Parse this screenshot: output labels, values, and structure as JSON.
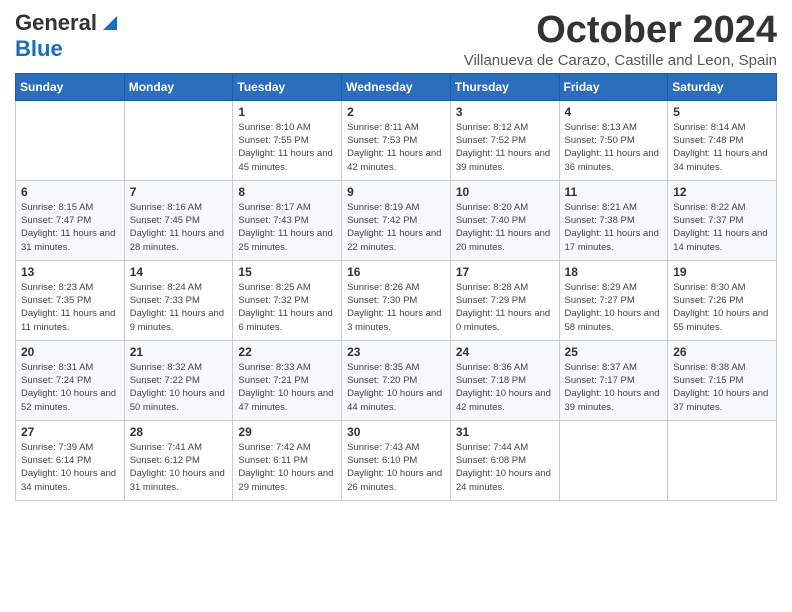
{
  "header": {
    "logo_general": "General",
    "logo_blue": "Blue",
    "month_title": "October 2024",
    "subtitle": "Villanueva de Carazo, Castille and Leon, Spain"
  },
  "weekdays": [
    "Sunday",
    "Monday",
    "Tuesday",
    "Wednesday",
    "Thursday",
    "Friday",
    "Saturday"
  ],
  "weeks": [
    [
      {
        "day": "",
        "info": ""
      },
      {
        "day": "",
        "info": ""
      },
      {
        "day": "1",
        "info": "Sunrise: 8:10 AM\nSunset: 7:55 PM\nDaylight: 11 hours and 45 minutes."
      },
      {
        "day": "2",
        "info": "Sunrise: 8:11 AM\nSunset: 7:53 PM\nDaylight: 11 hours and 42 minutes."
      },
      {
        "day": "3",
        "info": "Sunrise: 8:12 AM\nSunset: 7:52 PM\nDaylight: 11 hours and 39 minutes."
      },
      {
        "day": "4",
        "info": "Sunrise: 8:13 AM\nSunset: 7:50 PM\nDaylight: 11 hours and 36 minutes."
      },
      {
        "day": "5",
        "info": "Sunrise: 8:14 AM\nSunset: 7:48 PM\nDaylight: 11 hours and 34 minutes."
      }
    ],
    [
      {
        "day": "6",
        "info": "Sunrise: 8:15 AM\nSunset: 7:47 PM\nDaylight: 11 hours and 31 minutes."
      },
      {
        "day": "7",
        "info": "Sunrise: 8:16 AM\nSunset: 7:45 PM\nDaylight: 11 hours and 28 minutes."
      },
      {
        "day": "8",
        "info": "Sunrise: 8:17 AM\nSunset: 7:43 PM\nDaylight: 11 hours and 25 minutes."
      },
      {
        "day": "9",
        "info": "Sunrise: 8:19 AM\nSunset: 7:42 PM\nDaylight: 11 hours and 22 minutes."
      },
      {
        "day": "10",
        "info": "Sunrise: 8:20 AM\nSunset: 7:40 PM\nDaylight: 11 hours and 20 minutes."
      },
      {
        "day": "11",
        "info": "Sunrise: 8:21 AM\nSunset: 7:38 PM\nDaylight: 11 hours and 17 minutes."
      },
      {
        "day": "12",
        "info": "Sunrise: 8:22 AM\nSunset: 7:37 PM\nDaylight: 11 hours and 14 minutes."
      }
    ],
    [
      {
        "day": "13",
        "info": "Sunrise: 8:23 AM\nSunset: 7:35 PM\nDaylight: 11 hours and 11 minutes."
      },
      {
        "day": "14",
        "info": "Sunrise: 8:24 AM\nSunset: 7:33 PM\nDaylight: 11 hours and 9 minutes."
      },
      {
        "day": "15",
        "info": "Sunrise: 8:25 AM\nSunset: 7:32 PM\nDaylight: 11 hours and 6 minutes."
      },
      {
        "day": "16",
        "info": "Sunrise: 8:26 AM\nSunset: 7:30 PM\nDaylight: 11 hours and 3 minutes."
      },
      {
        "day": "17",
        "info": "Sunrise: 8:28 AM\nSunset: 7:29 PM\nDaylight: 11 hours and 0 minutes."
      },
      {
        "day": "18",
        "info": "Sunrise: 8:29 AM\nSunset: 7:27 PM\nDaylight: 10 hours and 58 minutes."
      },
      {
        "day": "19",
        "info": "Sunrise: 8:30 AM\nSunset: 7:26 PM\nDaylight: 10 hours and 55 minutes."
      }
    ],
    [
      {
        "day": "20",
        "info": "Sunrise: 8:31 AM\nSunset: 7:24 PM\nDaylight: 10 hours and 52 minutes."
      },
      {
        "day": "21",
        "info": "Sunrise: 8:32 AM\nSunset: 7:22 PM\nDaylight: 10 hours and 50 minutes."
      },
      {
        "day": "22",
        "info": "Sunrise: 8:33 AM\nSunset: 7:21 PM\nDaylight: 10 hours and 47 minutes."
      },
      {
        "day": "23",
        "info": "Sunrise: 8:35 AM\nSunset: 7:20 PM\nDaylight: 10 hours and 44 minutes."
      },
      {
        "day": "24",
        "info": "Sunrise: 8:36 AM\nSunset: 7:18 PM\nDaylight: 10 hours and 42 minutes."
      },
      {
        "day": "25",
        "info": "Sunrise: 8:37 AM\nSunset: 7:17 PM\nDaylight: 10 hours and 39 minutes."
      },
      {
        "day": "26",
        "info": "Sunrise: 8:38 AM\nSunset: 7:15 PM\nDaylight: 10 hours and 37 minutes."
      }
    ],
    [
      {
        "day": "27",
        "info": "Sunrise: 7:39 AM\nSunset: 6:14 PM\nDaylight: 10 hours and 34 minutes."
      },
      {
        "day": "28",
        "info": "Sunrise: 7:41 AM\nSunset: 6:12 PM\nDaylight: 10 hours and 31 minutes."
      },
      {
        "day": "29",
        "info": "Sunrise: 7:42 AM\nSunset: 6:11 PM\nDaylight: 10 hours and 29 minutes."
      },
      {
        "day": "30",
        "info": "Sunrise: 7:43 AM\nSunset: 6:10 PM\nDaylight: 10 hours and 26 minutes."
      },
      {
        "day": "31",
        "info": "Sunrise: 7:44 AM\nSunset: 6:08 PM\nDaylight: 10 hours and 24 minutes."
      },
      {
        "day": "",
        "info": ""
      },
      {
        "day": "",
        "info": ""
      }
    ]
  ]
}
